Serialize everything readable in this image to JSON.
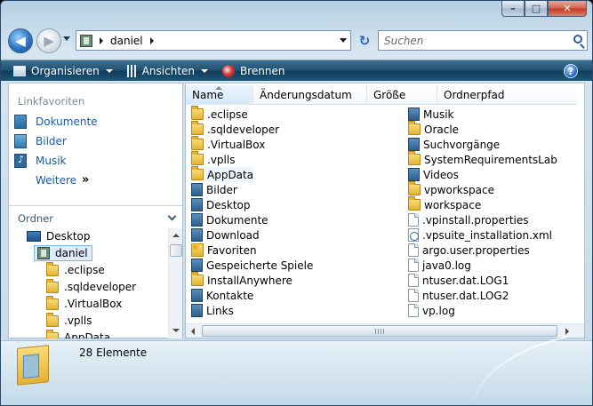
{
  "window": {
    "controls": {
      "minimize": "–",
      "maximize": "□",
      "close": "✕"
    }
  },
  "nav": {
    "back": "◀",
    "forward": "▶",
    "refresh": "↻"
  },
  "address": {
    "path": "daniel"
  },
  "search": {
    "placeholder": "Suchen"
  },
  "toolbar": {
    "organize": "Organisieren",
    "views": "Ansichten",
    "burn": "Brennen",
    "help": "?"
  },
  "favorites": {
    "heading": "Linkfavoriten",
    "items": [
      "Dokumente",
      "Bilder",
      "Musik"
    ],
    "more": "Weitere",
    "more_arrows": "»"
  },
  "folders": {
    "heading": "Ordner",
    "tree": [
      "Desktop",
      "daniel",
      ".eclipse",
      ".sqldeveloper",
      ".VirtualBox",
      ".vplls",
      "AppData"
    ]
  },
  "columns": {
    "name": "Name",
    "date": "Änderungsdatum",
    "size": "Größe",
    "path": "Ordnerpfad"
  },
  "files_left": [
    {
      "name": ".eclipse",
      "icon": "folder-icon"
    },
    {
      "name": ".sqldeveloper",
      "icon": "folder-icon"
    },
    {
      "name": ".VirtualBox",
      "icon": "folder-icon"
    },
    {
      "name": ".vplls",
      "icon": "folder-icon"
    },
    {
      "name": "AppData",
      "icon": "folder-icon"
    },
    {
      "name": "Bilder",
      "icon": "library-icon"
    },
    {
      "name": "Desktop",
      "icon": "library-icon"
    },
    {
      "name": "Dokumente",
      "icon": "library-icon"
    },
    {
      "name": "Download",
      "icon": "library-icon"
    },
    {
      "name": "Favoriten",
      "icon": "star-folder-icon"
    },
    {
      "name": "Gespeicherte Spiele",
      "icon": "library-icon"
    },
    {
      "name": "InstallAnywhere",
      "icon": "folder-icon"
    },
    {
      "name": "Kontakte",
      "icon": "library-icon"
    },
    {
      "name": "Links",
      "icon": "library-icon"
    }
  ],
  "files_right": [
    {
      "name": "Musik",
      "icon": "library-icon"
    },
    {
      "name": "Oracle",
      "icon": "folder-icon"
    },
    {
      "name": "Suchvorgänge",
      "icon": "library-icon"
    },
    {
      "name": "SystemRequirementsLab",
      "icon": "folder-icon"
    },
    {
      "name": "Videos",
      "icon": "library-icon"
    },
    {
      "name": "vpworkspace",
      "icon": "folder-icon"
    },
    {
      "name": "workspace",
      "icon": "folder-icon"
    },
    {
      "name": ".vpinstall.properties",
      "icon": "document-icon"
    },
    {
      "name": ".vpsuite_installation.xml",
      "icon": "xml-icon"
    },
    {
      "name": "argo.user.properties",
      "icon": "document-icon"
    },
    {
      "name": "java0.log",
      "icon": "document-icon"
    },
    {
      "name": "ntuser.dat.LOG1",
      "icon": "document-icon"
    },
    {
      "name": "ntuser.dat.LOG2",
      "icon": "document-icon"
    },
    {
      "name": "vp.log",
      "icon": "document-icon"
    }
  ],
  "details": {
    "count": "28 Elemente"
  }
}
